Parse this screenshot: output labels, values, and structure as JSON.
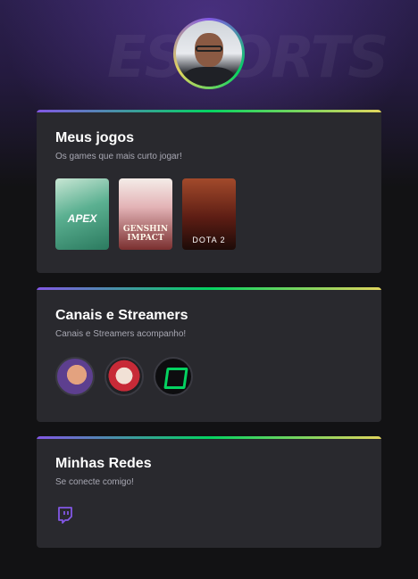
{
  "profile": {
    "avatar_icon": "user-avatar",
    "background_watermark": "ESPORTS"
  },
  "games_card": {
    "title": "Meus jogos",
    "subtitle": "Os games que mais curto jogar!",
    "games": [
      {
        "name": "APEX",
        "icon": "apex-legends-cover"
      },
      {
        "name": "GENSHIN IMPACT",
        "icon": "genshin-impact-cover"
      },
      {
        "name": "DOTA 2",
        "icon": "dota-2-cover"
      }
    ]
  },
  "streamers_card": {
    "title": "Canais e Streamers",
    "subtitle": "Canais e Streamers acompanho!",
    "streamers": [
      {
        "icon": "streamer-avatar-1"
      },
      {
        "icon": "streamer-avatar-2"
      },
      {
        "icon": "streamer-avatar-3"
      }
    ]
  },
  "social_card": {
    "title": "Minhas Redes",
    "subtitle": "Se conecte comigo!",
    "links": [
      {
        "icon": "twitch-icon"
      }
    ]
  },
  "colors": {
    "background": "#121214",
    "card": "#29292e",
    "accent_purple": "#8257e5",
    "accent_green": "#04d361",
    "accent_yellow": "#e1d55d",
    "text_primary": "#ffffff",
    "text_secondary": "#a8a8b3"
  }
}
